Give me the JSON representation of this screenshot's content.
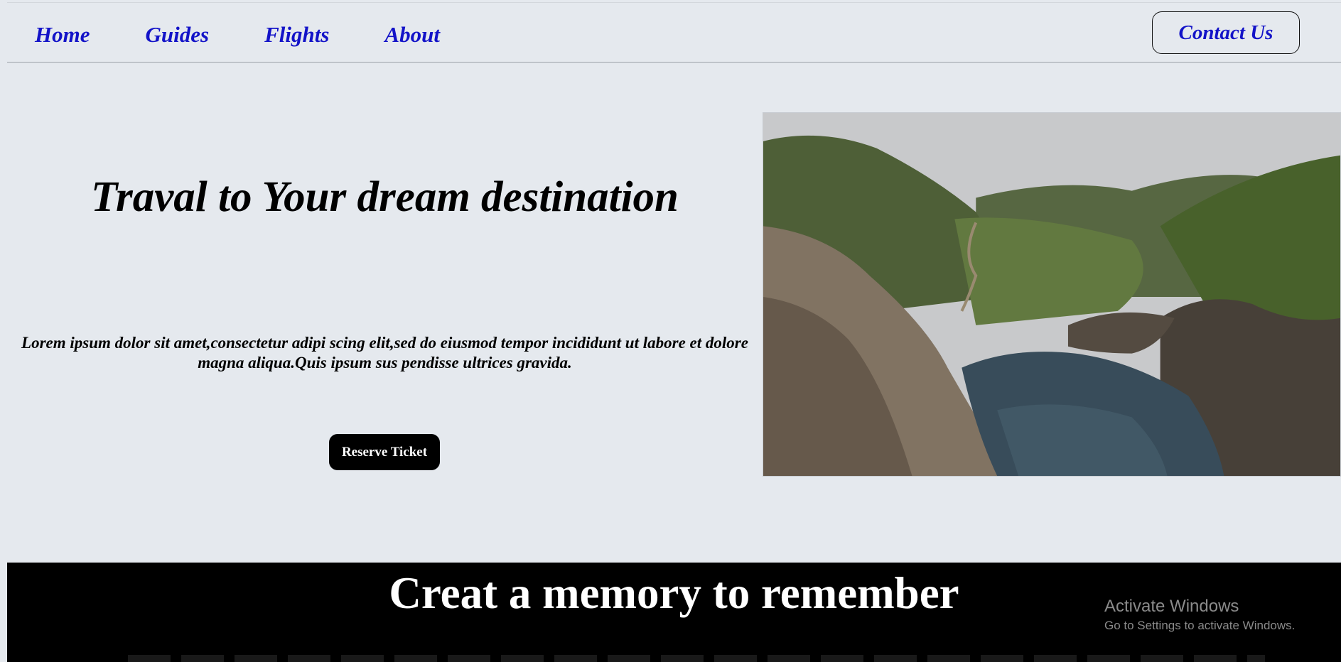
{
  "nav": {
    "items": [
      {
        "label": "Home"
      },
      {
        "label": "Guides"
      },
      {
        "label": "Flights"
      },
      {
        "label": "About"
      }
    ],
    "contact_label": "Contact Us"
  },
  "hero": {
    "title": "Traval to Your dream destination",
    "text": "Lorem ipsum dolor sit amet,consectetur adipi scing elit,sed do eiusmod tempor incididunt ut labore et dolore magna aliqua.Quis ipsum sus pendisse ultrices gravida.",
    "button_label": "Reserve Ticket"
  },
  "memory": {
    "title": "Creat a memory to remember"
  },
  "watermark": {
    "title": "Activate Windows",
    "subtitle": "Go to Settings to activate Windows."
  },
  "colors": {
    "background": "#e5e9ee",
    "nav_link": "#1313c8",
    "band": "#000000",
    "button": "#000000"
  }
}
